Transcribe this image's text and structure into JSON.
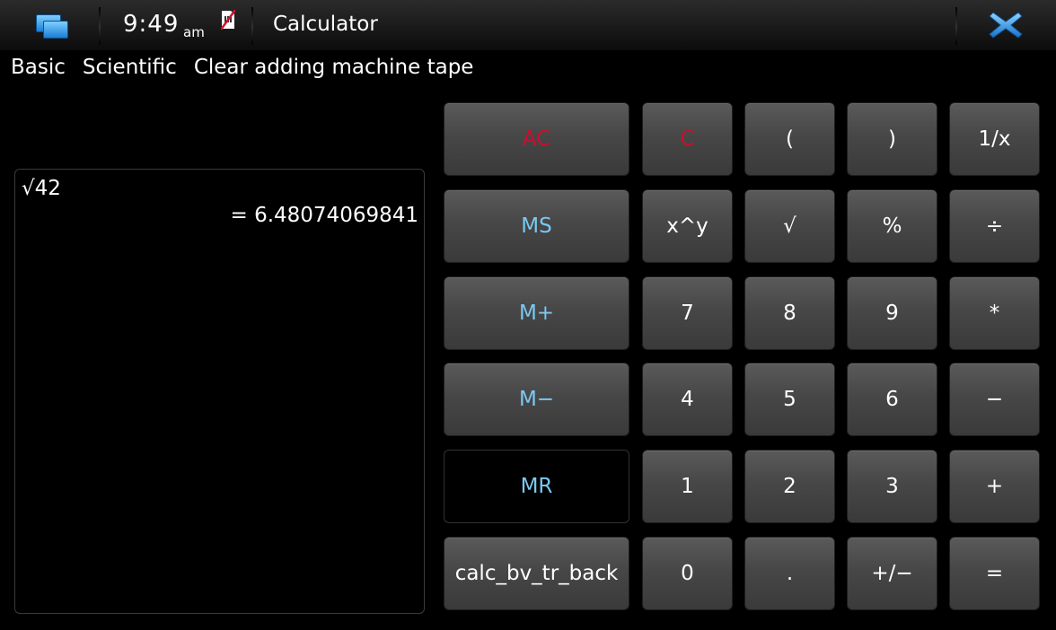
{
  "statusbar": {
    "time": "9:49",
    "ampm": "am",
    "app_title": "Calculator"
  },
  "menu": [
    "Basic",
    "Scientific",
    "Clear adding machine tape"
  ],
  "tape": {
    "expression": "√42",
    "result": "= 6.48074069841"
  },
  "keys": {
    "ac": "AC",
    "c": "C",
    "lparen": "(",
    "rparen": ")",
    "reciprocal": "1/x",
    "ms": "MS",
    "pow": "x^y",
    "sqrt": "√",
    "percent": "%",
    "divide": "÷",
    "mplus": "M+",
    "seven": "7",
    "eight": "8",
    "nine": "9",
    "multiply": "*",
    "mminus": "M−",
    "four": "4",
    "five": "5",
    "six": "6",
    "minus": "−",
    "mr": "MR",
    "one": "1",
    "two": "2",
    "three": "3",
    "plus": "+",
    "back": "calc_bv_tr_back",
    "zero": "0",
    "dot": ".",
    "negate": "+/−",
    "equals": "="
  },
  "colors": {
    "clear_keys": "#c8102e",
    "memory_keys": "#7cc8f2",
    "close_icon": "#1e8ae0"
  }
}
